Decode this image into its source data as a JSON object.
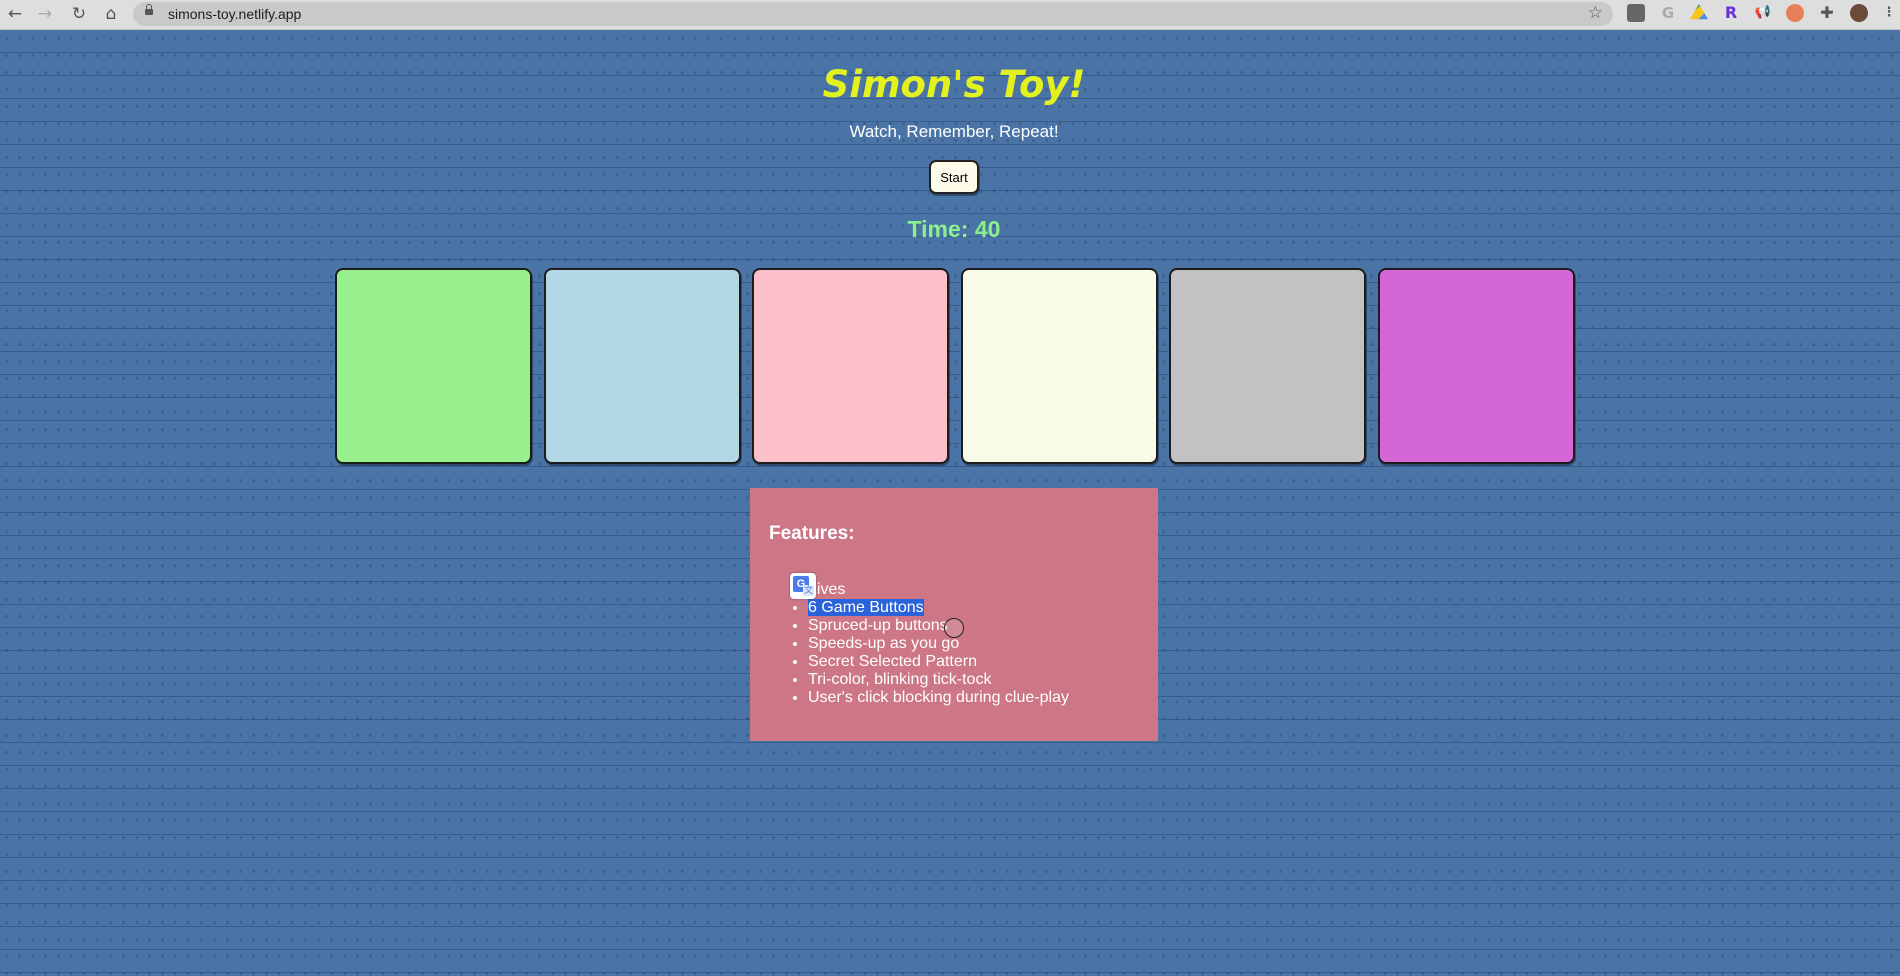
{
  "browser": {
    "url": "simons-toy.netlify.app",
    "back_icon": "←",
    "forward_icon": "→",
    "reload_icon": "↻",
    "home_icon": "⌂",
    "star_icon": "☆"
  },
  "header": {
    "title": "Simon's Toy!",
    "subtitle": "Watch, Remember, Repeat!",
    "start_label": "Start"
  },
  "timer": {
    "label": "Time: ",
    "value": "40"
  },
  "game_buttons": [
    {
      "name": "green",
      "color": "#98f08c"
    },
    {
      "name": "lightblue",
      "color": "#b2d8e6"
    },
    {
      "name": "pink",
      "color": "#fcc0cb"
    },
    {
      "name": "beige",
      "color": "#f9fae8"
    },
    {
      "name": "silver",
      "color": "#c2c2c2"
    },
    {
      "name": "orchid",
      "color": "#d566d5"
    }
  ],
  "features": {
    "heading": "Features:",
    "items": [
      "Lives",
      "6 Game Buttons",
      "Spruced-up buttons",
      "Speeds-up as you go",
      "Secret Selected Pattern",
      "Tri-color, blinking tick-tock",
      "User's click blocking during clue-play"
    ]
  },
  "colors": {
    "page_background": "#4a74a6",
    "title": "#e3f21f",
    "timer": "#8cf08c",
    "features_panel": "#cc7686",
    "selection": "#2a63d9"
  }
}
